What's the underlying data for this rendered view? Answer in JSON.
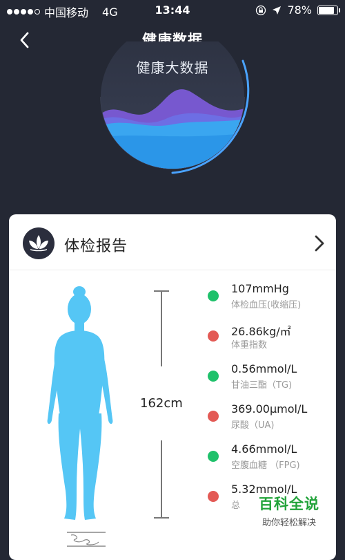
{
  "status_bar": {
    "carrier": "中国移动",
    "network": "4G",
    "time": "13:44",
    "battery": "78%",
    "battery_level": 0.78
  },
  "nav": {
    "title": "健康数据"
  },
  "hero": {
    "title": "健康大数据"
  },
  "card": {
    "title": "体检报告",
    "height": "162cm",
    "metrics": [
      {
        "value": "107mmHg",
        "label": "体检血压(收缩压)",
        "status": "normal"
      },
      {
        "value": "26.86kg/㎡",
        "label": "体重指数",
        "status": "abnormal"
      },
      {
        "value": "0.56mmol/L",
        "label": "甘油三酯（TG)",
        "status": "normal"
      },
      {
        "value": "369.00μmol/L",
        "label": "尿酸（UA)",
        "status": "abnormal"
      },
      {
        "value": "4.66mmol/L",
        "label": "空腹血糖 （FPG)",
        "status": "normal"
      },
      {
        "value": "5.32mmol/L",
        "label": "总",
        "status": "abnormal"
      }
    ]
  },
  "watermark": {
    "title": "百科全说",
    "subtitle": "助你轻松解决"
  },
  "colors": {
    "background": "#242834",
    "normal": "#1fc16b",
    "abnormal": "#e35a55",
    "accent": "#4aa3ff",
    "figure": "#55c6f5"
  },
  "icons": [
    "back-arrow",
    "lotus",
    "chevron-right",
    "lock-rotation",
    "location-arrow",
    "battery"
  ]
}
